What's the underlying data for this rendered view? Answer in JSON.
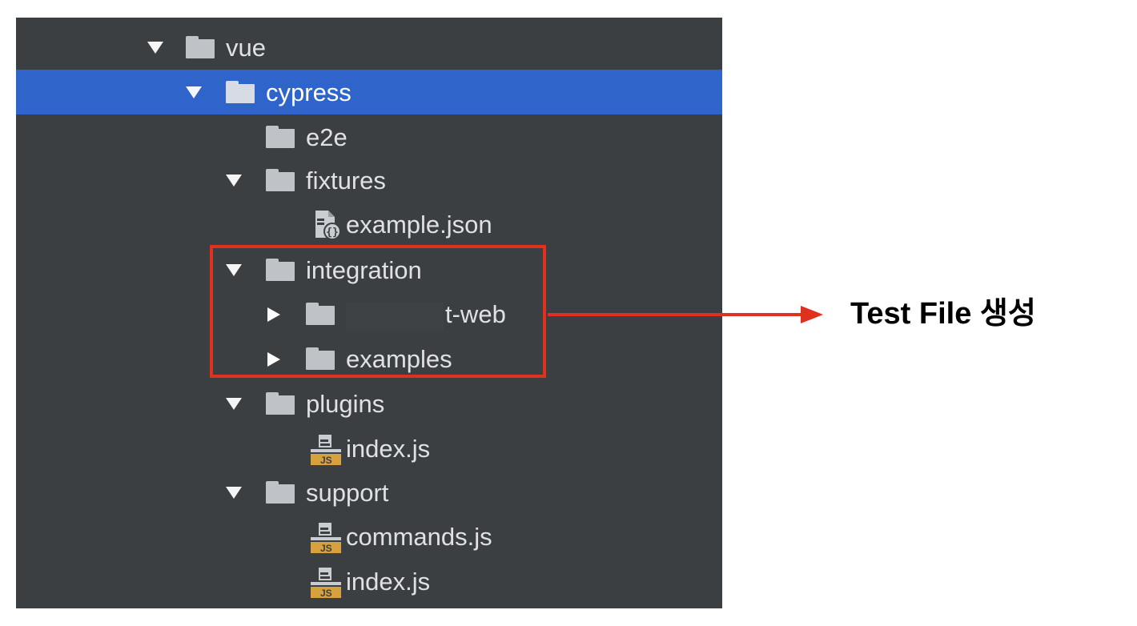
{
  "tree": {
    "items": [
      {
        "label": "vue",
        "type": "folder",
        "expanded": true,
        "selected": false
      },
      {
        "label": "cypress",
        "type": "folder",
        "expanded": true,
        "selected": true
      },
      {
        "label": "e2e",
        "type": "folder",
        "expanded": false,
        "selected": false
      },
      {
        "label": "fixtures",
        "type": "folder",
        "expanded": true,
        "selected": false
      },
      {
        "label": "example.json",
        "type": "json-file",
        "selected": false
      },
      {
        "label": "integration",
        "type": "folder",
        "expanded": true,
        "selected": false
      },
      {
        "label": "t-web",
        "type": "folder",
        "expanded": false,
        "selected": false,
        "partially_redacted": true
      },
      {
        "label": "examples",
        "type": "folder",
        "expanded": false,
        "selected": false
      },
      {
        "label": "plugins",
        "type": "folder",
        "expanded": true,
        "selected": false
      },
      {
        "label": "index.js",
        "type": "js-file",
        "selected": false
      },
      {
        "label": "support",
        "type": "folder",
        "expanded": true,
        "selected": false
      },
      {
        "label": "commands.js",
        "type": "js-file",
        "selected": false
      },
      {
        "label": "index.js",
        "type": "js-file",
        "selected": false
      }
    ],
    "js_badge": "JS"
  },
  "annotation": {
    "text": "Test File 생성"
  },
  "colors": {
    "panel_bg": "#3c3f41",
    "selection": "#2f65ca",
    "highlight": "#e0301e",
    "js_badge": "#d7a23d"
  }
}
